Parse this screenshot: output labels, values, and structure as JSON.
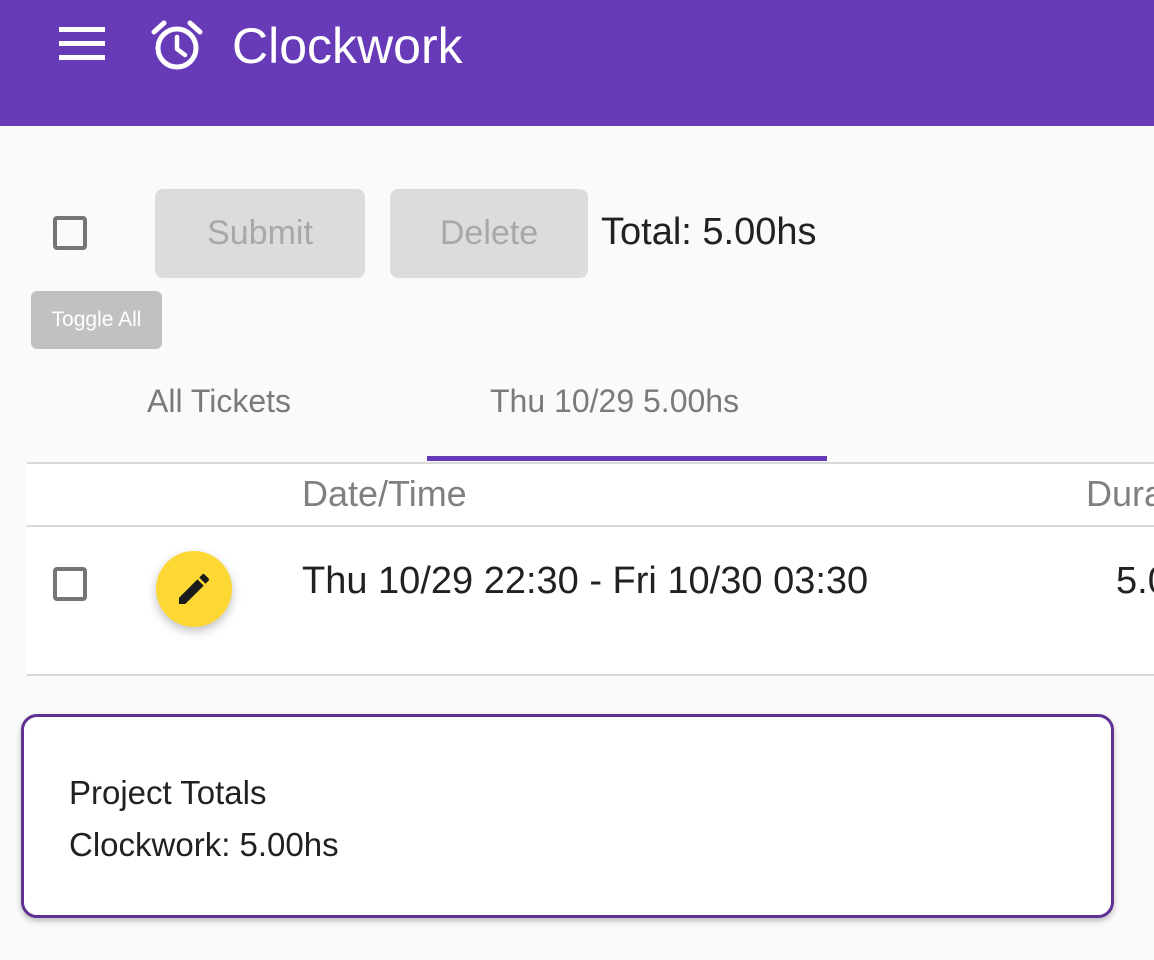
{
  "app": {
    "title": "Clockwork",
    "accent_color": "#673ab7",
    "menu_icon": "menu-icon",
    "logo_icon": "alarm-clock-icon"
  },
  "toolbar": {
    "submit_label": "Submit",
    "delete_label": "Delete",
    "total_text": "Total: 5.00hs",
    "toggle_all_label": "Toggle All",
    "select_all_checked": false
  },
  "tabs": [
    {
      "label": "All Tickets",
      "active": false
    },
    {
      "label": "Thu 10/29 5.00hs",
      "active": true
    }
  ],
  "table": {
    "columns": [
      "",
      "",
      "Date/Time",
      "Dura"
    ],
    "rows": [
      {
        "checked": false,
        "action_icon": "pencil-icon",
        "action_color": "#fdd835",
        "datetime": "Thu 10/29 22:30 - Fri 10/30 03:30",
        "duration": "5.0"
      }
    ]
  },
  "project_totals": {
    "heading": "Project Totals",
    "lines": [
      "Clockwork: 5.00hs"
    ],
    "border_color": "#5e3192"
  }
}
